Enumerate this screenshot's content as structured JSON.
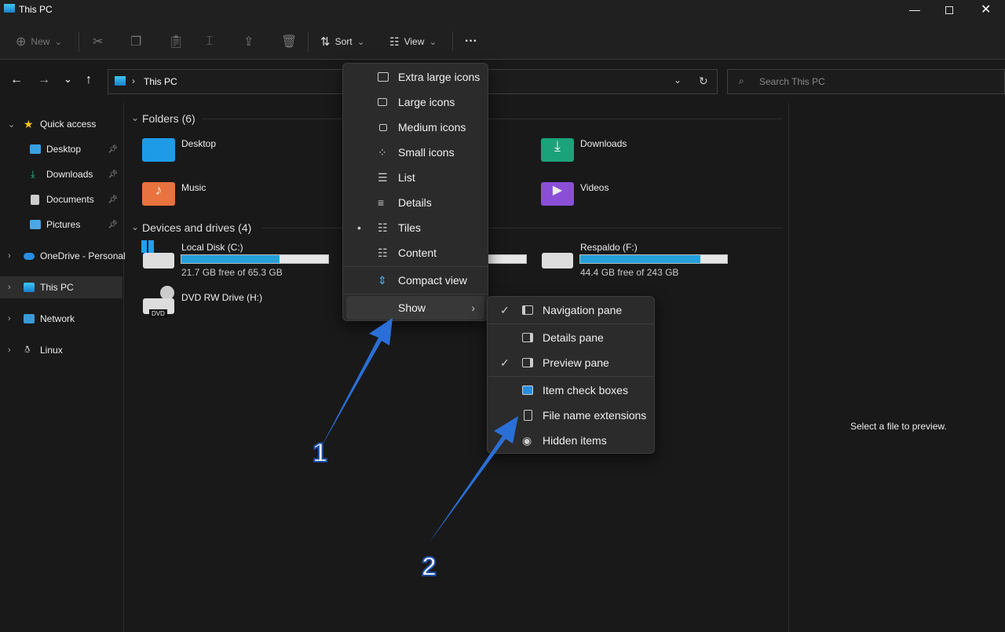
{
  "window": {
    "title": "This PC"
  },
  "toolbar": {
    "new": "New",
    "sort": "Sort",
    "view": "View",
    "more": "···"
  },
  "address": {
    "path": "This PC",
    "search_placeholder": "Search This PC"
  },
  "sidebar": {
    "items": [
      {
        "label": "Quick access",
        "icon": "star-icon"
      },
      {
        "label": "Desktop",
        "icon": "desktop-icon",
        "pinned": true
      },
      {
        "label": "Downloads",
        "icon": "download-icon",
        "pinned": true
      },
      {
        "label": "Documents",
        "icon": "document-icon",
        "pinned": true
      },
      {
        "label": "Pictures",
        "icon": "pictures-icon",
        "pinned": true
      },
      {
        "label": "OneDrive - Personal",
        "icon": "cloud-icon"
      },
      {
        "label": "This PC",
        "icon": "computer-icon",
        "selected": true
      },
      {
        "label": "Network",
        "icon": "network-icon"
      },
      {
        "label": "Linux",
        "icon": "linux-icon"
      }
    ]
  },
  "main": {
    "folders_header": "Folders (6)",
    "folders": [
      {
        "name": "Desktop",
        "color": "#1e9be6"
      },
      {
        "name": "Downloads",
        "color": "#1aa37a"
      },
      {
        "name": "Music",
        "color": "#e8733e"
      },
      {
        "name": "Videos",
        "color": "#8a4fd6"
      }
    ],
    "drives_header": "Devices and drives (4)",
    "drives": [
      {
        "name": "Local Disk (C:)",
        "free": "21.7 GB free of 65.3 GB",
        "used_fraction": 0.668
      },
      {
        "name": "Respaldo (F:)",
        "free": "44.4 GB free of 243 GB",
        "used_fraction": 0.817
      },
      {
        "name": "DVD RW Drive (H:)",
        "badge": "DVD"
      }
    ]
  },
  "preview": {
    "text": "Select a file to preview."
  },
  "view_menu": {
    "items": [
      {
        "label": "Extra large icons"
      },
      {
        "label": "Large icons"
      },
      {
        "label": "Medium icons"
      },
      {
        "label": "Small icons"
      },
      {
        "label": "List"
      },
      {
        "label": "Details"
      },
      {
        "label": "Tiles",
        "selected": true
      },
      {
        "label": "Content"
      },
      {
        "label": "Compact view"
      },
      {
        "label": "Show"
      }
    ]
  },
  "show_menu": {
    "items": [
      {
        "label": "Navigation pane",
        "checked": true
      },
      {
        "label": "Details pane",
        "checked": false
      },
      {
        "label": "Preview pane",
        "checked": true
      },
      {
        "label": "Item check boxes"
      },
      {
        "label": "File name extensions"
      },
      {
        "label": "Hidden items"
      }
    ]
  },
  "annotations": {
    "one": "1",
    "two": "2",
    "arrow_color": "#2a6fd6"
  }
}
